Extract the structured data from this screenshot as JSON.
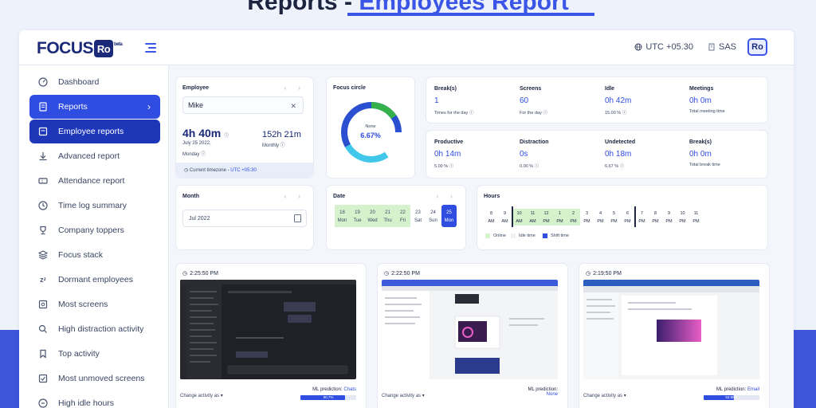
{
  "heading": {
    "part1": "Reports",
    "separator": "-",
    "part2": "Employees Report"
  },
  "topbar": {
    "logo_text": "FOCUS",
    "logo_badge": "Ro",
    "logo_tag": "beta",
    "timezone": "UTC +05.30",
    "org": "SAS",
    "avatar": "Ro"
  },
  "sidebar": {
    "items": [
      {
        "label": "Dashboard",
        "icon": "dashboard-icon"
      },
      {
        "label": "Reports",
        "icon": "reports-icon"
      },
      {
        "label": "Employee reports",
        "icon": "employee-reports-icon"
      },
      {
        "label": "Advanced report",
        "icon": "download-icon"
      },
      {
        "label": "Attendance report",
        "icon": "ticket-icon"
      },
      {
        "label": "Time log summary",
        "icon": "clock-icon"
      },
      {
        "label": "Company toppers",
        "icon": "trophy-icon"
      },
      {
        "label": "Focus stack",
        "icon": "layers-icon"
      },
      {
        "label": "Dormant employees",
        "icon": "zzz-icon"
      },
      {
        "label": "Most screens",
        "icon": "screen-icon"
      },
      {
        "label": "High distraction activity",
        "icon": "distraction-icon"
      },
      {
        "label": "Top activity",
        "icon": "bookmark-icon"
      },
      {
        "label": "Most unmoved screens",
        "icon": "unmoved-icon"
      },
      {
        "label": "High idle hours",
        "icon": "idle-icon"
      }
    ]
  },
  "employee": {
    "title": "Employee",
    "value": "Mike",
    "total_time": "4h 40m",
    "date": "July 25 2022,",
    "weekday": "Monday",
    "monthly_time": "152h 21m",
    "monthly_label": "Monthly",
    "tz_label": "Current timezone -",
    "tz_value": "UTC +05:30"
  },
  "focus": {
    "title": "Focus circle",
    "center_label": "None",
    "center_value": "6.67%",
    "colors": [
      "#2a4fd0",
      "#40c7ea",
      "#36b04a"
    ]
  },
  "stats_row1": [
    {
      "label": "Break(s)",
      "value": "1",
      "sub": "Times for the day"
    },
    {
      "label": "Screens",
      "value": "60",
      "sub": "For the day"
    },
    {
      "label": "Idle",
      "value": "0h 42m",
      "sub": "15.00 %"
    },
    {
      "label": "Meetings",
      "value": "0h 0m",
      "sub": "Total meeting time"
    }
  ],
  "stats_row2": [
    {
      "label": "Productive",
      "value": "0h 14m",
      "sub": "5.00 %"
    },
    {
      "label": "Distraction",
      "value": "0s",
      "sub": "0.00 %"
    },
    {
      "label": "Undetected",
      "value": "0h 18m",
      "sub": "6.67 %"
    },
    {
      "label": "Break(s)",
      "value": "0h 0m",
      "sub": "Total break time"
    }
  ],
  "month": {
    "title": "Month",
    "value": "Jul 2022"
  },
  "date": {
    "title": "Date",
    "days": [
      {
        "num": "18",
        "name": "Mon"
      },
      {
        "num": "19",
        "name": "Tue"
      },
      {
        "num": "20",
        "name": "Wed"
      },
      {
        "num": "21",
        "name": "Thu"
      },
      {
        "num": "22",
        "name": "Fri"
      },
      {
        "num": "23",
        "name": "Sat"
      },
      {
        "num": "24",
        "name": "Sun"
      },
      {
        "num": "25",
        "name": "Mon"
      }
    ]
  },
  "hours": {
    "title": "Hours",
    "slots": [
      {
        "h": "8",
        "p": "AM"
      },
      {
        "h": "9",
        "p": "AM"
      },
      {
        "h": "10",
        "p": "AM"
      },
      {
        "h": "11",
        "p": "AM"
      },
      {
        "h": "12",
        "p": "PM"
      },
      {
        "h": "1",
        "p": "PM"
      },
      {
        "h": "2",
        "p": "PM"
      },
      {
        "h": "3",
        "p": "PM"
      },
      {
        "h": "4",
        "p": "PM"
      },
      {
        "h": "5",
        "p": "PM"
      },
      {
        "h": "6",
        "p": "PM"
      },
      {
        "h": "7",
        "p": "PM"
      },
      {
        "h": "8",
        "p": "PM"
      },
      {
        "h": "9",
        "p": "PM"
      },
      {
        "h": "10",
        "p": "PM"
      },
      {
        "h": "11",
        "p": "PM"
      }
    ],
    "legend": {
      "online": "Online",
      "idle": "Idle time",
      "shift": "Shift time"
    }
  },
  "screenshots": [
    {
      "time": "2:25:50 PM",
      "change": "Change activity as",
      "ml_label": "ML prediction:",
      "ml_value": "Chats",
      "progress_label": "80.7%",
      "progress": 0.807
    },
    {
      "time": "2:22:50 PM",
      "change": "Change activity as",
      "ml_label": "ML prediction:",
      "ml_value": "None",
      "progress_label": "",
      "progress": 0
    },
    {
      "time": "2:19:50 PM",
      "change": "Change activity as",
      "ml_label": "ML prediction:",
      "ml_value": "Email",
      "progress_label": "53.88%",
      "progress": 0.5388
    }
  ]
}
